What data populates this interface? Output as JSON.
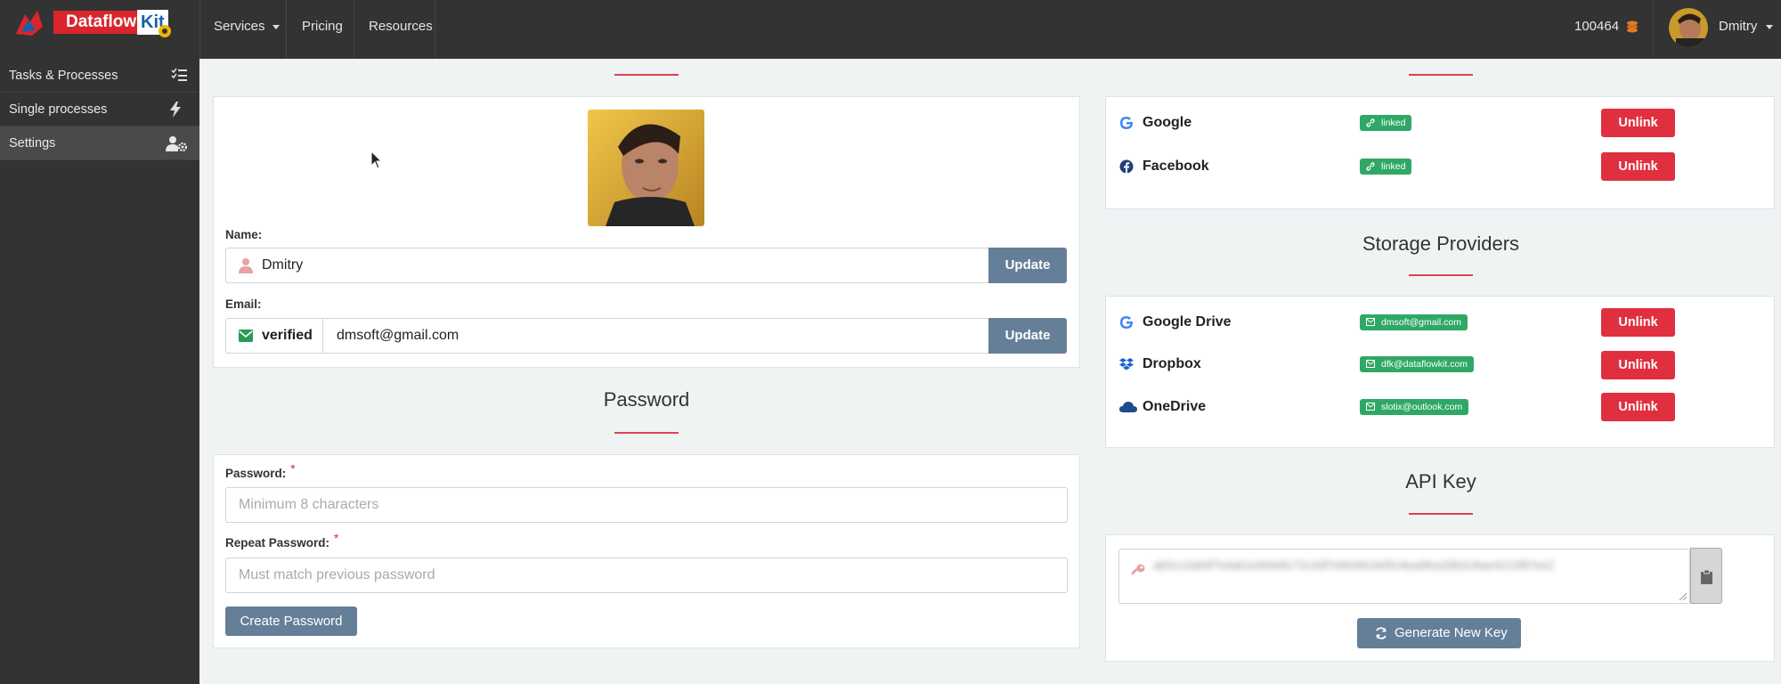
{
  "brand": {
    "logo_text": "Dataflow",
    "logo_kit": "Kit"
  },
  "nav": {
    "services": "Services",
    "pricing": "Pricing",
    "resources": "Resources",
    "credits": "100464",
    "user": "Dmitry"
  },
  "sidebar": {
    "items": [
      {
        "label": "Tasks & Processes",
        "icon": "list-check-icon"
      },
      {
        "label": "Single processes",
        "icon": "bolt-icon"
      },
      {
        "label": "Settings",
        "icon": "user-cog-icon",
        "active": true
      }
    ]
  },
  "profile": {
    "name_label": "Name:",
    "name_value": "Dmitry",
    "email_label": "Email:",
    "email_status": "verified",
    "email_value": "dmsoft@gmail.com",
    "update_label": "Update"
  },
  "password": {
    "title": "Password",
    "password_label": "Password:",
    "password_placeholder": "Minimum 8 characters",
    "repeat_label": "Repeat Password:",
    "repeat_placeholder": "Must match previous password",
    "required_mark": "*",
    "create_label": "Create Password"
  },
  "social": {
    "providers": [
      {
        "name": "Google",
        "badge": "linked",
        "action": "Unlink"
      },
      {
        "name": "Facebook",
        "badge": "linked",
        "action": "Unlink"
      }
    ]
  },
  "storage": {
    "title": "Storage Providers",
    "providers": [
      {
        "name": "Google Drive",
        "badge": "dmsoft@gmail.com",
        "action": "Unlink"
      },
      {
        "name": "Dropbox",
        "badge": "dfk@dataflowkit.com",
        "action": "Unlink"
      },
      {
        "name": "OneDrive",
        "badge": "slotix@outlook.com",
        "action": "Unlink"
      }
    ]
  },
  "api": {
    "title": "API Key",
    "key_value": "ab5cc2a84f7e4ab1e93e6fc72c43f7e8446c0ef5c6ea9fea33b2c8ae4212f87ee2",
    "generate_label": "Generate New Key"
  },
  "colors": {
    "topbar": "#333333",
    "accent_red": "#e0303f",
    "button_slate": "#667f98",
    "badge_green": "#2fa866"
  }
}
